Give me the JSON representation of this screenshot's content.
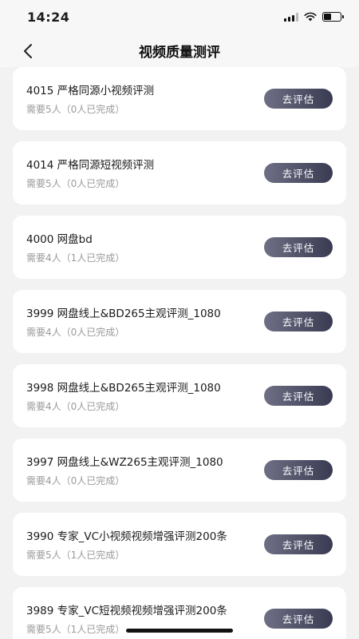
{
  "status_bar": {
    "time": "14:24"
  },
  "nav": {
    "title": "视频质量测评"
  },
  "tasks": [
    {
      "title": "4015   严格同源小视频评测",
      "sub": "需要5人（0人已完成）",
      "button": "去评估"
    },
    {
      "title": "4014   严格同源短视频评测",
      "sub": "需要5人（0人已完成）",
      "button": "去评估"
    },
    {
      "title": "4000   网盘bd",
      "sub": "需要4人（1人已完成）",
      "button": "去评估"
    },
    {
      "title": "3999   网盘线上&BD265主观评测_1080",
      "sub": "需要4人（0人已完成）",
      "button": "去评估"
    },
    {
      "title": "3998   网盘线上&BD265主观评测_1080",
      "sub": "需要4人（0人已完成）",
      "button": "去评估"
    },
    {
      "title": "3997   网盘线上&WZ265主观评测_1080",
      "sub": "需要4人（0人已完成）",
      "button": "去评估"
    },
    {
      "title": "3990   专家_VC小视频视频增强评测200条",
      "sub": "需要5人（1人已完成）",
      "button": "去评估"
    },
    {
      "title": "3989   专家_VC短视频视频增强评测200条",
      "sub": "需要5人（1人已完成）",
      "button": "去评估"
    }
  ]
}
